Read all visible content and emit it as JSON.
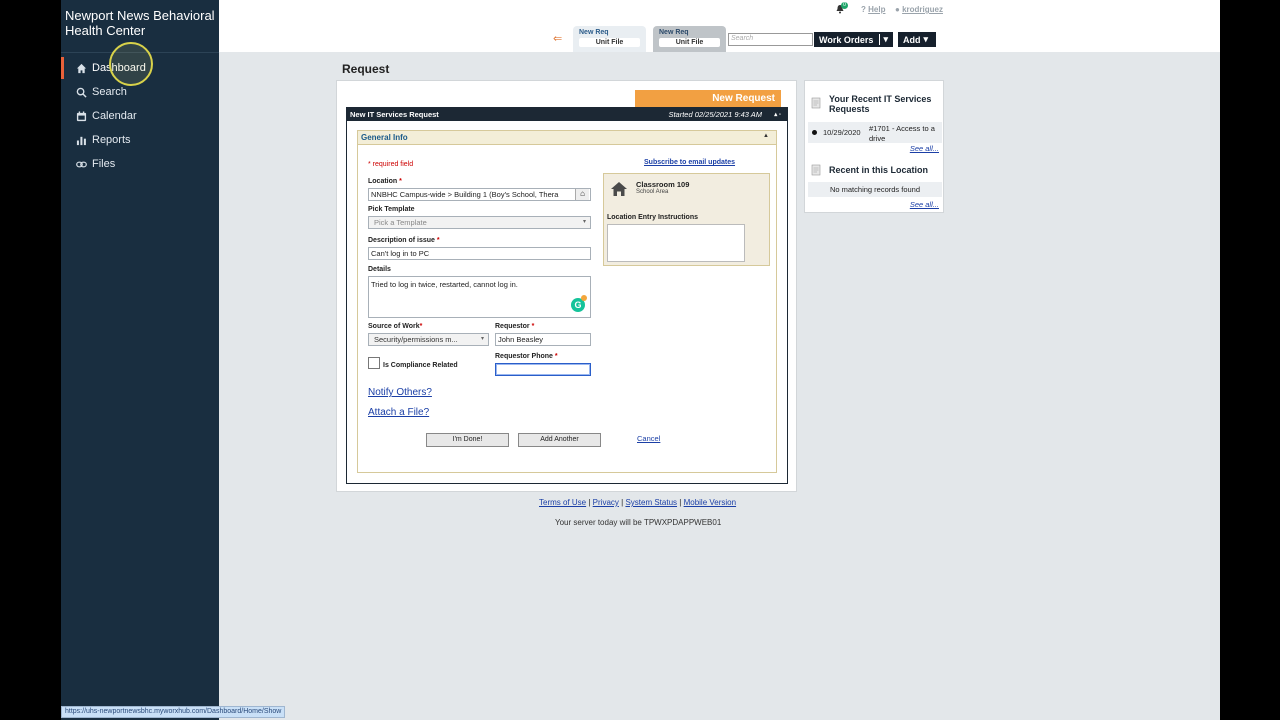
{
  "sidebar": {
    "brand": "Newport News Behavioral Health Center",
    "items": [
      {
        "label": "Dashboard",
        "icon": "home-icon"
      },
      {
        "label": "Search",
        "icon": "search-icon"
      },
      {
        "label": "Calendar",
        "icon": "calendar-icon"
      },
      {
        "label": "Reports",
        "icon": "bar-chart-icon"
      },
      {
        "label": "Files",
        "icon": "link-icon"
      }
    ]
  },
  "topbar": {
    "notification_count": "0",
    "help_label": "Help",
    "user_label": "krodriguez",
    "tabs": [
      {
        "title": "New Req",
        "subtitle": "Unit File"
      },
      {
        "title": "New Req",
        "subtitle": "Unit File"
      }
    ],
    "search_placeholder": "Search",
    "work_orders_label": "Work Orders",
    "add_label": "Add"
  },
  "page_title": "Request",
  "request": {
    "tag": "New Request",
    "form_title": "New IT Services Request",
    "started": "Started 02/25/2021 9:43 AM",
    "section_title": "General Info",
    "required_note": "* required field",
    "subscribe_label": "Subscribe to email updates",
    "location_label": "Location",
    "location_value": "NNBHC Campus-wide > Building 1 (Boy's School, Thera",
    "template_label": "Pick Template",
    "template_placeholder": "Pick a Template",
    "description_label": "Description of issue",
    "description_value": "Can't log in to PC",
    "details_label": "Details",
    "details_value": "Tried to log in twice, restarted, cannot log in.",
    "source_label": "Source of Work",
    "source_value": "Security/permissions m...",
    "requestor_label": "Requestor",
    "requestor_value": "John Beasley",
    "compliance_label": "Is Compliance Related",
    "phone_label": "Requestor Phone",
    "phone_value": "",
    "notify_label": "Notify Others?",
    "attach_label": "Attach a File?",
    "done_label": "I'm Done!",
    "add_another_label": "Add Another",
    "cancel_label": "Cancel",
    "location_box": {
      "name": "Classroom 109",
      "type": "School Area",
      "instructions_label": "Location Entry Instructions"
    }
  },
  "recent": {
    "title": "Your Recent IT Services Requests",
    "items": [
      {
        "date": "10/29/2020",
        "desc": "#1701 - Access to a drive"
      }
    ],
    "see_all": "See all...",
    "location_title": "Recent in this Location",
    "no_match": "No matching records found",
    "location_see_all": "See all..."
  },
  "footer": {
    "links": [
      "Terms of Use",
      "Privacy",
      "System Status",
      "Mobile Version"
    ],
    "separator": "|",
    "server": "Your server today will be TPWXPDAPPWEB01"
  },
  "statusbar_url": "https://uhs-newportnewsbhc.myworxhub.com/Dashboard/Home/Show",
  "colors": {
    "sidebar": "#192e40",
    "accent": "#f2a042",
    "active": "#e8613a"
  }
}
